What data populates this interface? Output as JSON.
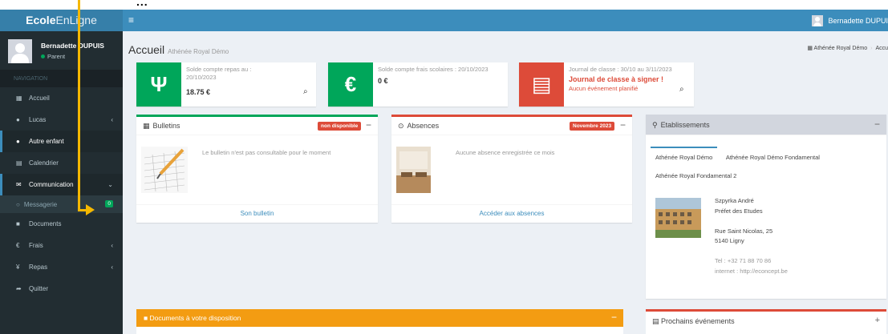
{
  "annotation": {
    "text": "..."
  },
  "brand": {
    "bold": "Ecole",
    "light": "EnLigne"
  },
  "header": {
    "menu_icon": "bars-icon",
    "user_name": "Bernadette DUPUI"
  },
  "sidebar": {
    "user_name": "Bernadette DUPUIS",
    "user_role": "Parent",
    "nav_header": "NAVIGATION",
    "items": [
      {
        "label": "Accueil",
        "icon": "th-icon"
      },
      {
        "label": "Lucas",
        "icon": "user-icon"
      },
      {
        "label": "Autre enfant",
        "icon": "users-icon"
      },
      {
        "label": "Calendrier",
        "icon": "calendar-icon"
      },
      {
        "label": "Communication",
        "icon": "envelope-icon"
      },
      {
        "label": "Messagerie",
        "icon": "circle-icon",
        "badge": "0"
      },
      {
        "label": "Documents",
        "icon": "folder-icon"
      },
      {
        "label": "Frais",
        "icon": "euro-icon"
      },
      {
        "label": "Repas",
        "icon": "cutlery-icon"
      },
      {
        "label": "Quitter",
        "icon": "share-icon"
      }
    ]
  },
  "page": {
    "title": "Accueil",
    "subtitle": "Athénée Royal Démo"
  },
  "breadcrumb": {
    "item1": "Athénée Royal Démo",
    "item2": "Accu"
  },
  "info_boxes": {
    "repas": {
      "label_line1": "Solde compte repas au :",
      "label_line2": "20/10/2023",
      "value": "18.75 €",
      "color": "#00a65a"
    },
    "frais": {
      "label": "Solde compte frais scolaires : 20/10/2023",
      "value": "0 €",
      "color": "#00a65a"
    },
    "journal": {
      "label": "Journal de classe : 30/10 au 3/11/2023",
      "alert": "Journal de classe à signer !",
      "sub": "Aucun événement planifié",
      "color": "#dd4b39"
    }
  },
  "bulletins": {
    "title": "Bulletins",
    "badge": "non disponible",
    "message": "Le bulletin n'est pas consultable pour le moment",
    "footer": "Son bulletin"
  },
  "absences": {
    "title": "Absences",
    "badge": "Novembre 2023",
    "message": "Aucune absence enregistrée ce mois",
    "footer": "Accéder aux absences"
  },
  "etablissements": {
    "title": "Etablissements",
    "tabs": [
      "Athénée Royal Démo",
      "Athénée Royal Démo Fondamental",
      "Athénée Royal Fondamental 2"
    ],
    "contact": {
      "name": "Szpyrka André",
      "role": "Préfet des Etudes",
      "street": "Rue Saint Nicolas, 25",
      "city": "5140 Ligny",
      "tel": "Tel : +32 71 88 70 86",
      "web": "internet : http://econcept.be"
    }
  },
  "documents": {
    "title": "Documents à votre disposition"
  },
  "prochains": {
    "title": "Prochains événements"
  }
}
